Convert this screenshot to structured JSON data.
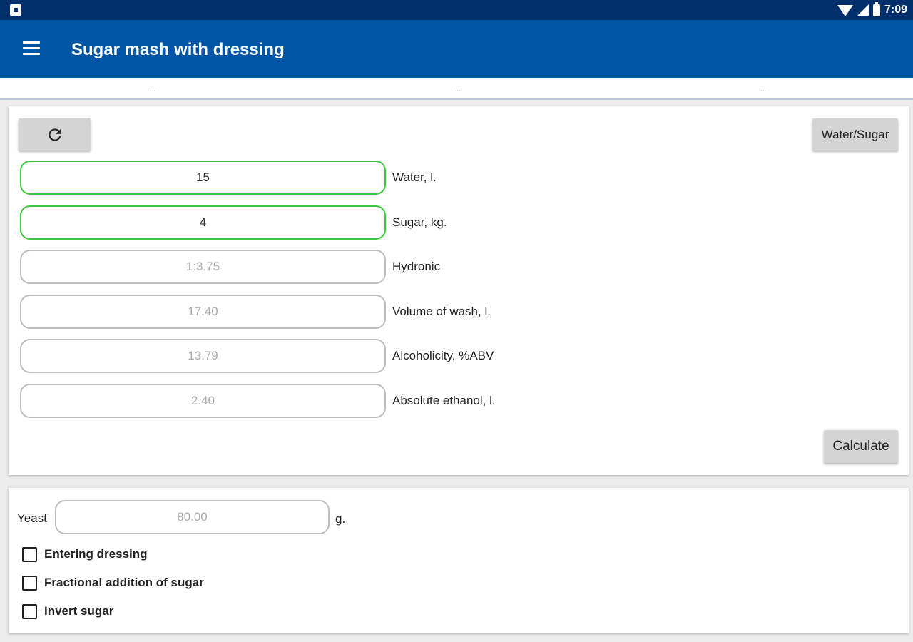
{
  "status_bar": {
    "time": "7:09",
    "icons": [
      "notification-icon",
      "wifi-icon",
      "signal-icon",
      "battery-icon"
    ]
  },
  "app_bar": {
    "title": "Sugar mash with dressing",
    "menu_icon": "menu-icon"
  },
  "tabs": [
    {
      "label": "..."
    },
    {
      "label": "..."
    },
    {
      "label": "..."
    }
  ],
  "calculator": {
    "refresh_icon": "refresh-icon",
    "water_sugar_label": "Water/Sugar",
    "calculate_label": "Calculate",
    "fields": [
      {
        "value": "15",
        "label": "Water, l.",
        "editable": true
      },
      {
        "value": "4",
        "label": "Sugar, kg.",
        "editable": true
      },
      {
        "value": "1:3.75",
        "label": "Hydronic",
        "editable": false
      },
      {
        "value": "17.40",
        "label": "Volume of wash, l.",
        "editable": false
      },
      {
        "value": "13.79",
        "label": "Alcoholicity, %ABV",
        "editable": false
      },
      {
        "value": "2.40",
        "label": "Absolute ethanol, l.",
        "editable": false
      }
    ]
  },
  "yeast": {
    "label": "Yeast",
    "value": "80.00",
    "unit": "g."
  },
  "options": [
    {
      "label": "Entering dressing",
      "checked": false
    },
    {
      "label": "Fractional addition of sugar",
      "checked": false
    },
    {
      "label": "Invert sugar",
      "checked": false
    }
  ],
  "colors": {
    "status_bar": "#002f6c",
    "app_bar": "#0155a5",
    "active_border": "#3fc83f"
  }
}
